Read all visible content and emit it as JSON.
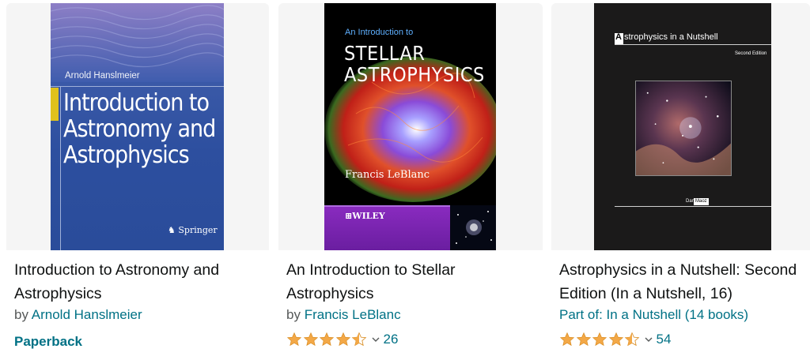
{
  "products": [
    {
      "title": "Introduction to Astronomy and Astrophysics",
      "by": "by",
      "author": "Arnold Hanslmeier",
      "format": "Paperback",
      "cover": {
        "author": "Arnold Hanslmeier",
        "title": "Introduction to Astronomy and Astrophysics",
        "publisher": "Springer",
        "colors": {
          "background": "#2d4f9f",
          "accent": "#e0c11c"
        }
      }
    },
    {
      "title": "An Introduction to Stellar Astrophysics",
      "by": "by",
      "author": "Francis LeBlanc",
      "rating": 4.5,
      "rating_count": "26",
      "cover": {
        "intro": "An Introduction to",
        "title_line1": "STELLAR",
        "title_line2": "ASTROPHYSICS",
        "author": "Francis LeBlanc",
        "publisher": "WILEY",
        "colors": {
          "band": "#7a22b0",
          "intro": "#5fb0ff"
        }
      }
    },
    {
      "title": "Astrophysics in a Nutshell: Second Edition (In a Nutshell, 16)",
      "series": "Part of: In a Nutshell (14 books)",
      "rating": 4.5,
      "rating_count": "54",
      "cover": {
        "title_initial": "A",
        "title_rest": "strophysics in a Nutshell",
        "edition": "Second Edition",
        "author_first": "Dan",
        "author_last": "Maoz",
        "colors": {
          "background": "#1b1a1a"
        }
      }
    }
  ],
  "colors": {
    "link": "#007185",
    "star": "#f3a847",
    "text": "#0f1111",
    "muted": "#565959"
  },
  "icons": {
    "rating_star": "star-icon",
    "rating_chevron": "chevron-down-icon"
  }
}
